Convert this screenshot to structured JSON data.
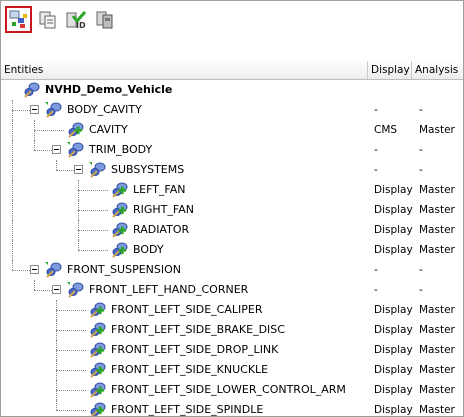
{
  "toolbar": {
    "buttons": [
      {
        "name": "entity-view-button",
        "icon": "entity-tree-color-icon",
        "selected": true
      },
      {
        "name": "entity-copy-button",
        "icon": "entity-copy-icon",
        "selected": false
      },
      {
        "name": "entity-id-check-button",
        "icon": "entity-id-check-icon",
        "selected": false
      },
      {
        "name": "entity-group-button",
        "icon": "entity-group-icon",
        "selected": false
      }
    ]
  },
  "header": {
    "entities": "Entities",
    "display": "Display",
    "analysis": "Analysis"
  },
  "tree": {
    "rows": [
      {
        "label": "NVHD_Demo_Vehicle",
        "display": "",
        "analysis": "",
        "bold": true
      },
      {
        "label": "BODY_CAVITY",
        "display": "-",
        "analysis": "-"
      },
      {
        "label": "CAVITY",
        "display": "CMS",
        "analysis": "Master"
      },
      {
        "label": "TRIM_BODY",
        "display": "-",
        "analysis": "-"
      },
      {
        "label": "SUBSYSTEMS",
        "display": "-",
        "analysis": "-"
      },
      {
        "label": "LEFT_FAN",
        "display": "Display",
        "analysis": "Master"
      },
      {
        "label": "RIGHT_FAN",
        "display": "Display",
        "analysis": "Master"
      },
      {
        "label": "RADIATOR",
        "display": "Display",
        "analysis": "Master"
      },
      {
        "label": "BODY",
        "display": "Display",
        "analysis": "Master"
      },
      {
        "label": "FRONT_SUSPENSION",
        "display": "-",
        "analysis": "-"
      },
      {
        "label": "FRONT_LEFT_HAND_CORNER",
        "display": "-",
        "analysis": "-"
      },
      {
        "label": "FRONT_LEFT_SIDE_CALIPER",
        "display": "Display",
        "analysis": "Master"
      },
      {
        "label": "FRONT_LEFT_SIDE_BRAKE_DISC",
        "display": "Display",
        "analysis": "Master"
      },
      {
        "label": "FRONT_LEFT_SIDE_DROP_LINK",
        "display": "Display",
        "analysis": "Master"
      },
      {
        "label": "FRONT_LEFT_SIDE_KNUCKLE",
        "display": "Display",
        "analysis": "Master"
      },
      {
        "label": "FRONT_LEFT_SIDE_LOWER_CONTROL_ARM",
        "display": "Display",
        "analysis": "Master"
      },
      {
        "label": "FRONT_LEFT_SIDE_SPINDLE",
        "display": "Display",
        "analysis": "Master"
      }
    ]
  },
  "colors": {
    "selected_border": "#c8161d",
    "tree_line": "#8a8a8a",
    "icon_blue": "#3f63c4",
    "icon_green": "#2aa52a"
  }
}
